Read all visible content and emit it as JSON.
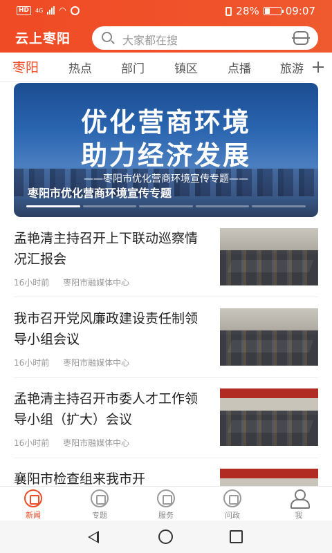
{
  "status_bar": {
    "network_badge": "HD",
    "network_type": "4G",
    "battery_percent": "28%",
    "time": "09:07"
  },
  "header": {
    "app_title": "云上枣阳",
    "search_placeholder": "大家都在搜"
  },
  "tabs": [
    "枣阳",
    "热点",
    "部门",
    "镇区",
    "点播",
    "旅游"
  ],
  "active_tab": 0,
  "banner": {
    "headline_line1": "优化营商环境",
    "headline_line2": "助力经济发展",
    "subtitle": "——枣阳市优化营商环境宣传专题——",
    "caption": "枣阳市优化营商环境宣传专题",
    "slide_count": 5,
    "active_slide": 0
  },
  "news": [
    {
      "title": "孟艳清主持召开上下联动巡察情况汇报会",
      "time": "16小时前",
      "source": "枣阳市融媒体中心"
    },
    {
      "title": "我市召开党风廉政建设责任制领导小组会议",
      "time": "16小时前",
      "source": "枣阳市融媒体中心"
    },
    {
      "title": "孟艳清主持召开市委人才工作领导小组（扩大）会议",
      "time": "16小时前",
      "source": "枣阳市融媒体中心"
    },
    {
      "title": "襄阳市检查组来我市开",
      "time": "",
      "source": ""
    }
  ],
  "bottom_nav": [
    {
      "label": "新闻",
      "icon": "news-icon",
      "active": true
    },
    {
      "label": "专题",
      "icon": "star-icon",
      "active": false
    },
    {
      "label": "服务",
      "icon": "service-icon",
      "active": false
    },
    {
      "label": "问政",
      "icon": "inquiry-icon",
      "active": false
    },
    {
      "label": "我",
      "icon": "person-icon",
      "active": false
    }
  ],
  "colors": {
    "brand": "#ef4b25",
    "text": "#222222",
    "meta": "#999999"
  }
}
